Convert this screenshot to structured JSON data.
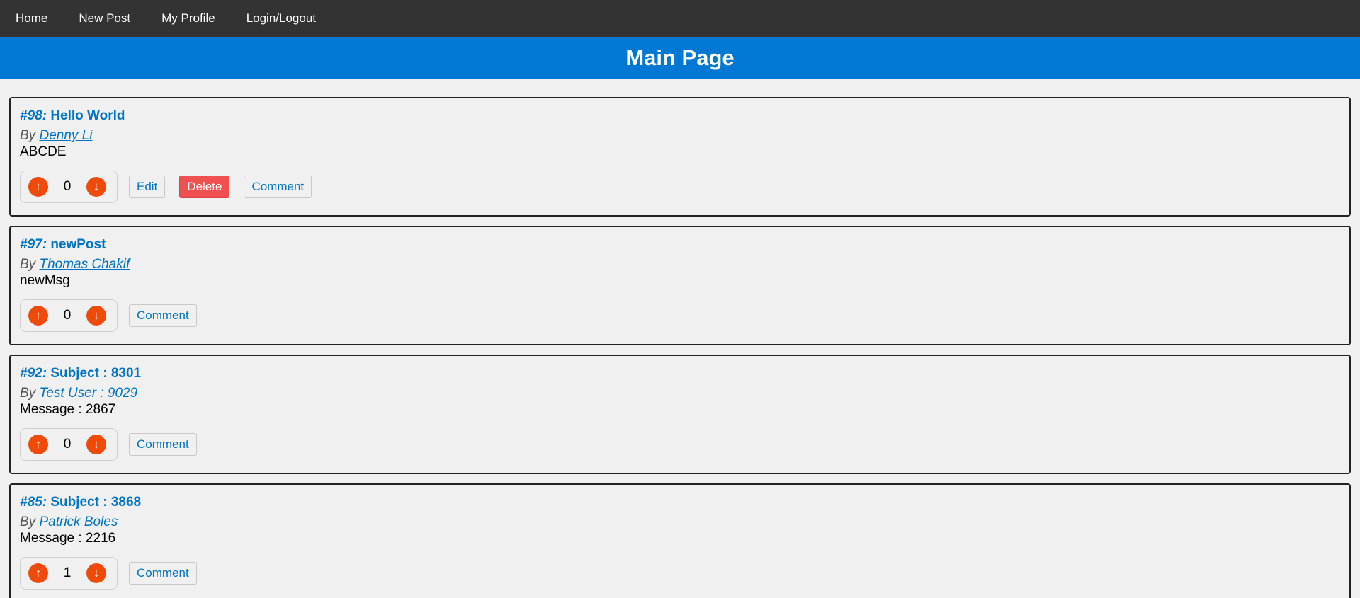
{
  "nav": {
    "items": [
      "Home",
      "New Post",
      "My Profile",
      "Login/Logout"
    ]
  },
  "header": {
    "title": "Main Page"
  },
  "posts": [
    {
      "id": "#98:",
      "subject": "Hello World",
      "by": "By",
      "author": "Denny Li",
      "message": "ABCDE",
      "votes": "0",
      "edit_label": "Edit",
      "delete_label": "Delete",
      "comment_label": "Comment"
    },
    {
      "id": "#97:",
      "subject": "newPost",
      "by": "By",
      "author": "Thomas Chakif",
      "message": "newMsg",
      "votes": "0",
      "comment_label": "Comment"
    },
    {
      "id": "#92:",
      "subject": "Subject : 8301",
      "by": "By",
      "author": "Test User : 9029",
      "message": "Message : 2867",
      "votes": "0",
      "comment_label": "Comment"
    },
    {
      "id": "#85:",
      "subject": "Subject : 3868",
      "by": "By",
      "author": "Patrick Boles",
      "message": "Message : 2216",
      "votes": "1",
      "comment_label": "Comment"
    }
  ],
  "icons": {
    "upvote": "↑",
    "downvote": "↓"
  },
  "colors": {
    "navbar": "#333333",
    "header": "#0078d4",
    "link": "#0074c2",
    "vote": "#f04a0a",
    "delete": "#f15050"
  }
}
